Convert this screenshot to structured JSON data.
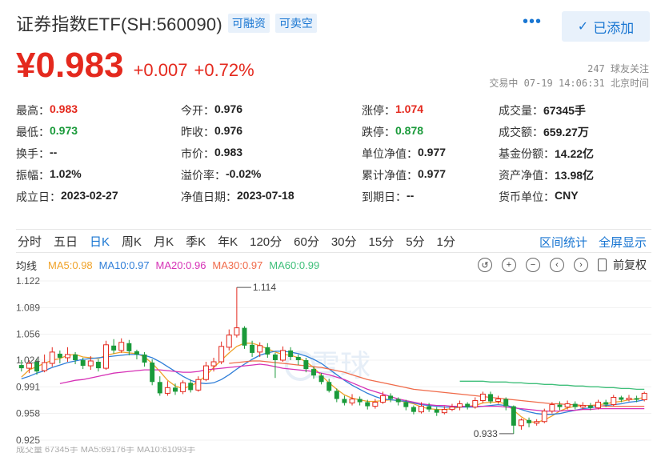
{
  "header": {
    "title": "证券指数ETF(SH:560090)",
    "tags": [
      "可融资",
      "可卖空"
    ],
    "more_label": "•••",
    "added_label": "已添加"
  },
  "quote": {
    "price": "¥0.983",
    "change": "+0.007",
    "change_pct": "+0.72%",
    "followers": "247 球友关注",
    "status": "交易中 07-19 14:06:31 北京时间"
  },
  "stats": [
    [
      {
        "label": "最高：",
        "value": "0.983",
        "color": "red"
      },
      {
        "label": "今开：",
        "value": "0.976"
      },
      {
        "label": "涨停：",
        "value": "1.074",
        "color": "red"
      },
      {
        "label": "成交量：",
        "value": "67345手"
      }
    ],
    [
      {
        "label": "最低：",
        "value": "0.973",
        "color": "green"
      },
      {
        "label": "昨收：",
        "value": "0.976"
      },
      {
        "label": "跌停：",
        "value": "0.878",
        "color": "green"
      },
      {
        "label": "成交额：",
        "value": "659.27万"
      }
    ],
    [
      {
        "label": "换手：",
        "value": "--"
      },
      {
        "label": "市价：",
        "value": "0.983"
      },
      {
        "label": "单位净值：",
        "value": "0.977"
      },
      {
        "label": "基金份额：",
        "value": "14.22亿"
      }
    ],
    [
      {
        "label": "振幅：",
        "value": "1.02%"
      },
      {
        "label": "溢价率：",
        "value": "-0.02%"
      },
      {
        "label": "累计净值：",
        "value": "0.977"
      },
      {
        "label": "资产净值：",
        "value": "13.98亿"
      }
    ],
    [
      {
        "label": "成立日：",
        "value": "2023-02-27"
      },
      {
        "label": "净值日期：",
        "value": "2023-07-18"
      },
      {
        "label": "到期日：",
        "value": "--"
      },
      {
        "label": "货币单位：",
        "value": "CNY"
      }
    ]
  ],
  "tabs": {
    "items": [
      "分时",
      "五日",
      "日K",
      "周K",
      "月K",
      "季K",
      "年K",
      "120分",
      "60分",
      "30分",
      "15分",
      "5分",
      "1分"
    ],
    "active": "日K",
    "right": [
      "区间统计",
      "全屏显示"
    ]
  },
  "ma": {
    "label": "均线",
    "items": [
      {
        "text": "MA5:0.98",
        "color": "#f0a32a"
      },
      {
        "text": "MA10:0.97",
        "color": "#2f7ed8"
      },
      {
        "text": "MA20:0.96",
        "color": "#d631b6"
      },
      {
        "text": "MA30:0.97",
        "color": "#f06b4a"
      },
      {
        "text": "MA60:0.99",
        "color": "#3fbf7a"
      }
    ],
    "tools": [
      "↺",
      "+",
      "−",
      "‹",
      "›"
    ],
    "restore_label": "前复权"
  },
  "chart_data": {
    "type": "candlestick",
    "y_ticks": [
      "1.122",
      "1.089",
      "1.056",
      "1.024",
      "0.991",
      "0.958",
      "0.925"
    ],
    "ylim": [
      0.925,
      1.122
    ],
    "max_label": "1.114",
    "min_label": "0.933",
    "watermark": "雪球",
    "up_color": "#e4291e",
    "down_color": "#1a9a3a",
    "candles": [
      [
        1.018,
        1.014,
        1.024,
        1.01
      ],
      [
        1.014,
        1.02,
        1.024,
        1.008
      ],
      [
        1.022,
        1.01,
        1.026,
        1.006
      ],
      [
        1.011,
        1.021,
        1.031,
        1.009
      ],
      [
        1.02,
        1.034,
        1.04,
        1.016
      ],
      [
        1.032,
        1.027,
        1.036,
        1.02
      ],
      [
        1.027,
        1.031,
        1.04,
        1.022
      ],
      [
        1.031,
        1.024,
        1.034,
        1.019
      ],
      [
        1.024,
        1.017,
        1.027,
        1.013
      ],
      [
        1.017,
        1.023,
        1.029,
        1.012
      ],
      [
        1.022,
        1.014,
        1.025,
        1.01
      ],
      [
        1.014,
        1.043,
        1.048,
        1.012
      ],
      [
        1.042,
        1.036,
        1.05,
        1.032
      ],
      [
        1.036,
        1.046,
        1.051,
        1.033
      ],
      [
        1.045,
        1.035,
        1.049,
        1.03
      ],
      [
        1.035,
        1.031,
        1.037,
        1.025
      ],
      [
        1.031,
        1.021,
        1.034,
        1.016
      ],
      [
        1.021,
        0.997,
        1.025,
        0.993
      ],
      [
        0.997,
        0.983,
        1.004,
        0.98
      ],
      [
        0.983,
        0.99,
        0.998,
        0.98
      ],
      [
        0.99,
        0.985,
        0.995,
        0.981
      ],
      [
        0.985,
        0.996,
        0.999,
        0.982
      ],
      [
        0.996,
        0.987,
        1.0,
        0.984
      ],
      [
        0.987,
        1.0,
        1.004,
        0.985
      ],
      [
        1.0,
        1.017,
        1.022,
        0.998
      ],
      [
        1.017,
        1.022,
        1.027,
        1.01
      ],
      [
        1.022,
        1.041,
        1.047,
        1.019
      ],
      [
        1.04,
        1.055,
        1.062,
        1.036
      ],
      [
        1.055,
        1.064,
        1.114,
        1.052
      ],
      [
        1.064,
        1.042,
        1.066,
        1.038
      ],
      [
        1.043,
        1.033,
        1.048,
        1.028
      ],
      [
        1.034,
        1.042,
        1.046,
        1.028
      ],
      [
        1.04,
        1.031,
        1.045,
        1.027
      ],
      [
        1.031,
        1.024,
        1.033,
        1.002
      ],
      [
        1.024,
        1.036,
        1.041,
        1.022
      ],
      [
        1.036,
        1.028,
        1.04,
        1.024
      ],
      [
        1.028,
        1.024,
        1.031,
        1.018
      ],
      [
        1.024,
        1.013,
        1.027,
        1.009
      ],
      [
        1.013,
        1.005,
        1.016,
        1.001
      ],
      [
        1.005,
        0.997,
        1.008,
        0.994
      ],
      [
        0.997,
        0.986,
        1.001,
        0.984
      ],
      [
        0.986,
        0.976,
        0.989,
        0.972
      ],
      [
        0.976,
        0.971,
        0.98,
        0.968
      ],
      [
        0.971,
        0.976,
        0.982,
        0.968
      ],
      [
        0.976,
        0.972,
        0.979,
        0.968
      ],
      [
        0.972,
        0.967,
        0.975,
        0.963
      ],
      [
        0.967,
        0.972,
        0.976,
        0.964
      ],
      [
        0.972,
        0.98,
        0.985,
        0.97
      ],
      [
        0.98,
        0.976,
        0.983,
        0.972
      ],
      [
        0.976,
        0.972,
        0.978,
        0.968
      ],
      [
        0.972,
        0.966,
        0.975,
        0.962
      ],
      [
        0.966,
        0.96,
        0.968,
        0.957
      ],
      [
        0.96,
        0.967,
        0.972,
        0.958
      ],
      [
        0.967,
        0.963,
        0.971,
        0.96
      ],
      [
        0.963,
        0.959,
        0.966,
        0.955
      ],
      [
        0.959,
        0.963,
        0.967,
        0.957
      ],
      [
        0.963,
        0.966,
        0.97,
        0.961
      ],
      [
        0.966,
        0.97,
        0.974,
        0.962
      ],
      [
        0.97,
        0.966,
        0.972,
        0.963
      ],
      [
        0.966,
        0.974,
        0.978,
        0.964
      ],
      [
        0.974,
        0.982,
        0.985,
        0.971
      ],
      [
        0.982,
        0.973,
        0.985,
        0.97
      ],
      [
        0.973,
        0.976,
        0.98,
        0.97
      ],
      [
        0.976,
        0.967,
        0.978,
        0.962
      ],
      [
        0.967,
        0.943,
        0.968,
        0.933
      ],
      [
        0.943,
        0.95,
        0.952,
        0.938
      ],
      [
        0.95,
        0.946,
        0.953,
        0.941
      ],
      [
        0.946,
        0.948,
        0.951,
        0.943
      ],
      [
        0.948,
        0.961,
        0.964,
        0.946
      ],
      [
        0.961,
        0.969,
        0.972,
        0.958
      ],
      [
        0.969,
        0.966,
        0.973,
        0.962
      ],
      [
        0.966,
        0.97,
        0.974,
        0.963
      ],
      [
        0.97,
        0.966,
        0.973,
        0.963
      ],
      [
        0.966,
        0.968,
        0.972,
        0.963
      ],
      [
        0.968,
        0.965,
        0.971,
        0.962
      ],
      [
        0.965,
        0.972,
        0.975,
        0.963
      ],
      [
        0.972,
        0.969,
        0.975,
        0.966
      ],
      [
        0.969,
        0.978,
        0.981,
        0.967
      ],
      [
        0.978,
        0.975,
        0.98,
        0.972
      ],
      [
        0.975,
        0.977,
        0.981,
        0.973
      ],
      [
        0.977,
        0.975,
        0.98,
        0.972
      ],
      [
        0.975,
        0.983,
        0.985,
        0.973
      ]
    ],
    "ma_lines": [
      {
        "name": "MA5",
        "color": "#f0a32a",
        "values": [
          1.003,
          1.012,
          1.016,
          1.02,
          1.024,
          1.026,
          1.03,
          1.031,
          1.028,
          1.027,
          1.026,
          1.03,
          1.032,
          1.034,
          1.033,
          1.032,
          1.028,
          1.02,
          1.01,
          0.999,
          0.992,
          0.989,
          0.992,
          0.997,
          1.005,
          1.015,
          1.024,
          1.033,
          1.041,
          1.045,
          1.045,
          1.042,
          1.038,
          1.034,
          1.031,
          1.03,
          1.027,
          1.022,
          1.015,
          1.005,
          0.996,
          0.988,
          0.981,
          0.977,
          0.975,
          0.973,
          0.973,
          0.974,
          0.975,
          0.974,
          0.972,
          0.97,
          0.966,
          0.964,
          0.963,
          0.963,
          0.964,
          0.966,
          0.967,
          0.968,
          0.971,
          0.972,
          0.972,
          0.97,
          0.962,
          0.954,
          0.948,
          0.947,
          0.95,
          0.955,
          0.961,
          0.965,
          0.967,
          0.968,
          0.968,
          0.969,
          0.97,
          0.972,
          0.973,
          0.975,
          0.976,
          0.978
        ]
      },
      {
        "name": "MA10",
        "color": "#2f7ed8",
        "values": [
          1.001,
          1.004,
          1.008,
          1.011,
          1.015,
          1.018,
          1.021,
          1.023,
          1.025,
          1.026,
          1.027,
          1.028,
          1.029,
          1.03,
          1.031,
          1.031,
          1.03,
          1.027,
          1.022,
          1.016,
          1.01,
          1.004,
          0.999,
          0.996,
          0.995,
          0.996,
          1.0,
          1.006,
          1.013,
          1.019,
          1.025,
          1.03,
          1.033,
          1.035,
          1.035,
          1.034,
          1.032,
          1.029,
          1.025,
          1.02,
          1.013,
          1.006,
          0.999,
          0.993,
          0.988,
          0.983,
          0.979,
          0.976,
          0.975,
          0.974,
          0.973,
          0.971,
          0.969,
          0.968,
          0.967,
          0.966,
          0.966,
          0.966,
          0.966,
          0.966,
          0.967,
          0.968,
          0.969,
          0.968,
          0.966,
          0.963,
          0.96,
          0.958,
          0.957,
          0.957,
          0.958,
          0.96,
          0.962,
          0.964,
          0.965,
          0.967,
          0.968,
          0.969,
          0.97,
          0.972,
          0.973,
          0.975
        ]
      },
      {
        "name": "MA20",
        "color": "#d631b6",
        "values": [
          null,
          null,
          null,
          null,
          null,
          0.995,
          0.997,
          0.999,
          1.0,
          1.002,
          1.004,
          1.006,
          1.008,
          1.009,
          1.01,
          1.011,
          1.012,
          1.012,
          1.012,
          1.011,
          1.01,
          1.009,
          1.009,
          1.01,
          1.012,
          1.013,
          1.014,
          1.015,
          1.016,
          1.017,
          1.018,
          1.019,
          1.018,
          1.016,
          1.014,
          1.013,
          1.012,
          1.011,
          1.01,
          1.008,
          1.006,
          1.003,
          1.0,
          0.996,
          0.992,
          0.988,
          0.985,
          0.982,
          0.979,
          0.976,
          0.974,
          0.972,
          0.97,
          0.969,
          0.968,
          0.968,
          0.967,
          0.967,
          0.967,
          0.967,
          0.967,
          0.967,
          0.967,
          0.966,
          0.965,
          0.964,
          0.963,
          0.962,
          0.961,
          0.961,
          0.961,
          0.962,
          0.962,
          0.963,
          0.963,
          0.964,
          0.964,
          0.964,
          0.964,
          0.964,
          0.964,
          0.964
        ]
      },
      {
        "name": "MA30",
        "color": "#f06b4a",
        "values": [
          null,
          null,
          null,
          null,
          null,
          null,
          null,
          null,
          null,
          null,
          null,
          null,
          null,
          null,
          null,
          null,
          null,
          null,
          null,
          null,
          null,
          null,
          null,
          null,
          null,
          null,
          null,
          1.02,
          1.021,
          1.022,
          1.023,
          1.023,
          1.022,
          1.021,
          1.02,
          1.019,
          1.018,
          1.017,
          1.016,
          1.015,
          1.013,
          1.011,
          1.009,
          1.006,
          1.003,
          1.0,
          0.998,
          0.996,
          0.994,
          0.992,
          0.99,
          0.988,
          0.987,
          0.986,
          0.985,
          0.984,
          0.983,
          0.982,
          0.981,
          0.98,
          0.979,
          0.978,
          0.977,
          0.976,
          0.975,
          0.974,
          0.973,
          0.972,
          0.971,
          0.97,
          0.97,
          0.969,
          0.969,
          0.968,
          0.968,
          0.968,
          0.967,
          0.967,
          0.967,
          0.967,
          0.967,
          0.967
        ]
      },
      {
        "name": "MA60",
        "color": "#3fbf7a",
        "values": [
          null,
          null,
          null,
          null,
          null,
          null,
          null,
          null,
          null,
          null,
          null,
          null,
          null,
          null,
          null,
          null,
          null,
          null,
          null,
          null,
          null,
          null,
          null,
          null,
          null,
          null,
          null,
          null,
          null,
          null,
          null,
          null,
          null,
          null,
          null,
          null,
          null,
          null,
          null,
          null,
          null,
          null,
          null,
          null,
          null,
          null,
          null,
          null,
          null,
          null,
          null,
          null,
          null,
          null,
          null,
          null,
          null,
          0.998,
          0.998,
          0.998,
          0.998,
          0.997,
          0.997,
          0.997,
          0.996,
          0.996,
          0.995,
          0.995,
          0.994,
          0.994,
          0.993,
          0.993,
          0.992,
          0.992,
          0.991,
          0.991,
          0.99,
          0.99,
          0.989,
          0.989,
          0.988,
          0.988
        ]
      }
    ]
  },
  "bottom": {
    "strip": "成交量 67345手   MA5:69176手   MA10:61093手"
  }
}
